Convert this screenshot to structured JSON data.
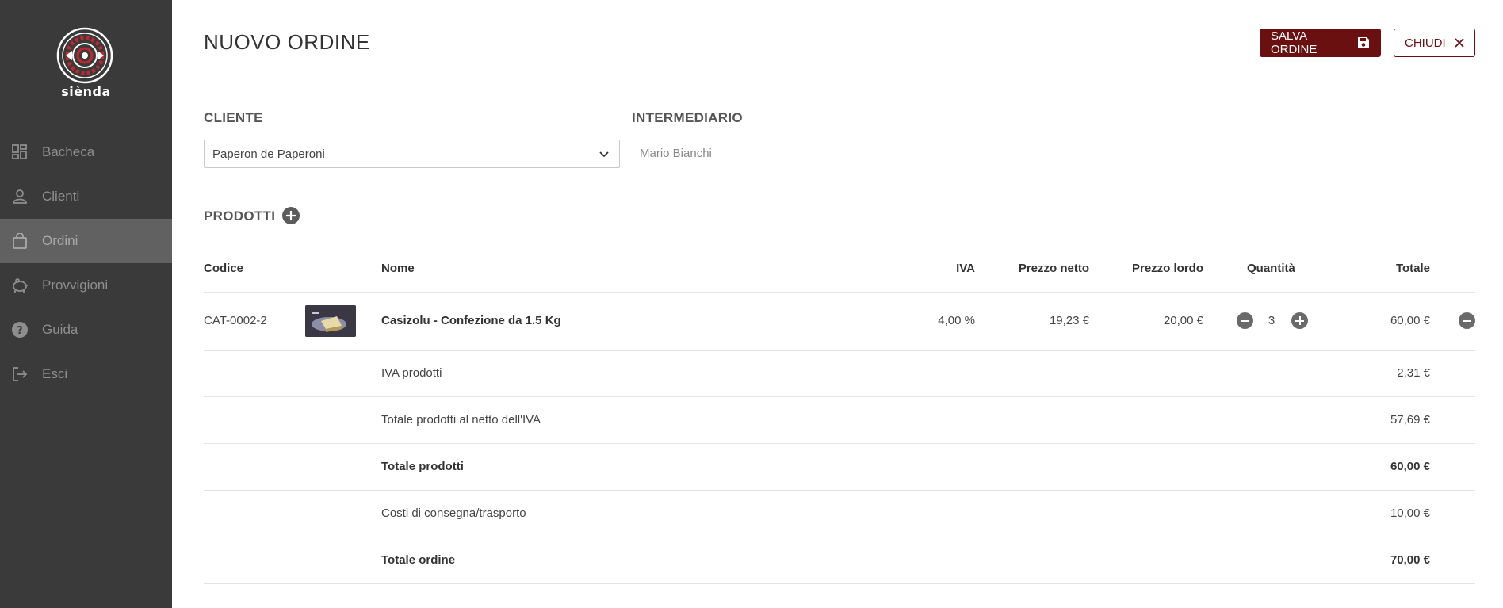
{
  "brand": {
    "name": "siènda",
    "accent_color": "#6b1010"
  },
  "sidebar": {
    "items": [
      {
        "label": "Bacheca",
        "icon": "dashboard-icon",
        "active": false
      },
      {
        "label": "Clienti",
        "icon": "person-icon",
        "active": false
      },
      {
        "label": "Ordini",
        "icon": "shopping-bag-icon",
        "active": true
      },
      {
        "label": "Provvigioni",
        "icon": "piggy-bank-icon",
        "active": false
      },
      {
        "label": "Guida",
        "icon": "help-icon",
        "active": false
      },
      {
        "label": "Esci",
        "icon": "logout-icon",
        "active": false
      }
    ]
  },
  "header": {
    "title": "NUOVO ORDINE",
    "save_label": "SALVA ORDINE",
    "close_label": "CHIUDI"
  },
  "form": {
    "cliente_label": "CLIENTE",
    "cliente_value": "Paperon de Paperoni",
    "intermediario_label": "INTERMEDIARIO",
    "intermediario_value": "Mario Bianchi",
    "prodotti_label": "PRODOTTI"
  },
  "table": {
    "headers": {
      "codice": "Codice",
      "nome": "Nome",
      "iva": "IVA",
      "prezzo_netto": "Prezzo netto",
      "prezzo_lordo": "Prezzo lordo",
      "quantita": "Quantità",
      "totale": "Totale"
    },
    "product": {
      "codice": "CAT-0002-2",
      "nome": "Casizolu - Confezione da 1.5 Kg",
      "iva": "4,00 %",
      "prezzo_netto": "19,23 €",
      "prezzo_lordo": "20,00 €",
      "quantita": "3",
      "totale": "60,00 €"
    },
    "summary": [
      {
        "label": "IVA prodotti",
        "value": "2,31 €",
        "bold": false
      },
      {
        "label": "Totale prodotti al netto dell'IVA",
        "value": "57,69 €",
        "bold": false
      },
      {
        "label": "Totale prodotti",
        "value": "60,00 €",
        "bold": true
      },
      {
        "label": "Costi di consegna/trasporto",
        "value": "10,00 €",
        "bold": false
      },
      {
        "label": "Totale ordine",
        "value": "70,00 €",
        "bold": true
      }
    ]
  }
}
